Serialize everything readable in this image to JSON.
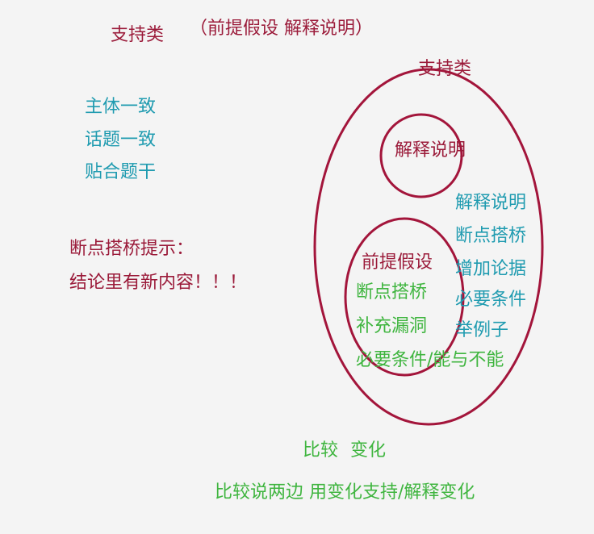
{
  "header": {
    "title": "支持类",
    "subtitle": "（前提假设 解释说明）"
  },
  "left_notes": {
    "items": [
      "主体一致",
      "话题一致",
      "贴合题干"
    ]
  },
  "hint": {
    "line1": "断点搭桥提示：",
    "line2": "结论里有新内容！！！"
  },
  "diagram": {
    "outer_label": "支持类",
    "inner_top_label": "解释说明",
    "inner_bottom_label": "前提假设",
    "inner_bottom_items": [
      "断点搭桥",
      "补充漏洞",
      "必要条件/能与不能"
    ],
    "right_items": [
      "解释说明",
      "断点搭桥",
      "增加论据",
      "必要条件",
      "举例子"
    ],
    "colors": {
      "ring": "#a3153b",
      "red_text": "#9b1b3a",
      "blue_text": "#1f9bb0",
      "green_text": "#3fb53f"
    }
  },
  "bottom": {
    "line1": "比较 变化",
    "line2": "比较说两边 用变化支持/解释变化"
  }
}
